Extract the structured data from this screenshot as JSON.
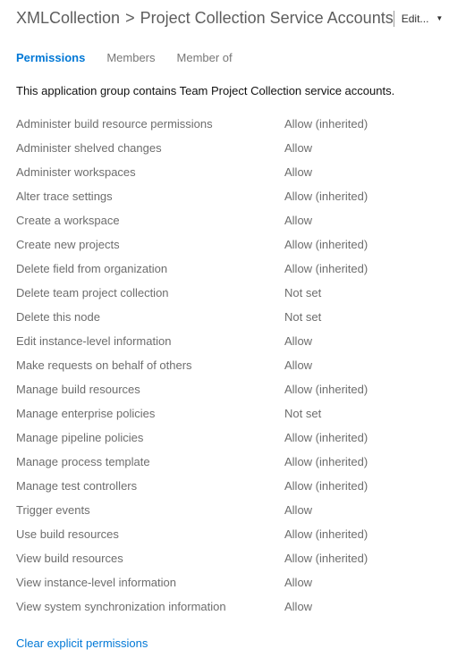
{
  "header": {
    "breadcrumb_collection": "XMLCollection",
    "breadcrumb_sep": ">",
    "breadcrumb_group": "Project Collection Service Accounts",
    "edit_label": "Edit..."
  },
  "tabs": {
    "permissions": "Permissions",
    "members": "Members",
    "memberof": "Member of"
  },
  "description": "This application group contains Team Project Collection service accounts.",
  "permissions": [
    {
      "name": "Administer build resource permissions",
      "value": "Allow (inherited)"
    },
    {
      "name": "Administer shelved changes",
      "value": "Allow"
    },
    {
      "name": "Administer workspaces",
      "value": "Allow"
    },
    {
      "name": "Alter trace settings",
      "value": "Allow (inherited)"
    },
    {
      "name": "Create a workspace",
      "value": "Allow"
    },
    {
      "name": "Create new projects",
      "value": "Allow (inherited)"
    },
    {
      "name": "Delete field from organization",
      "value": "Allow (inherited)"
    },
    {
      "name": "Delete team project collection",
      "value": "Not set"
    },
    {
      "name": "Delete this node",
      "value": "Not set"
    },
    {
      "name": "Edit instance-level information",
      "value": "Allow"
    },
    {
      "name": "Make requests on behalf of others",
      "value": "Allow"
    },
    {
      "name": "Manage build resources",
      "value": "Allow (inherited)"
    },
    {
      "name": "Manage enterprise policies",
      "value": "Not set"
    },
    {
      "name": "Manage pipeline policies",
      "value": "Allow (inherited)"
    },
    {
      "name": "Manage process template",
      "value": "Allow (inherited)"
    },
    {
      "name": "Manage test controllers",
      "value": "Allow (inherited)"
    },
    {
      "name": "Trigger events",
      "value": "Allow"
    },
    {
      "name": "Use build resources",
      "value": "Allow (inherited)"
    },
    {
      "name": "View build resources",
      "value": "Allow (inherited)"
    },
    {
      "name": "View instance-level information",
      "value": "Allow"
    },
    {
      "name": "View system synchronization information",
      "value": "Allow"
    }
  ],
  "clear_link": "Clear explicit permissions"
}
